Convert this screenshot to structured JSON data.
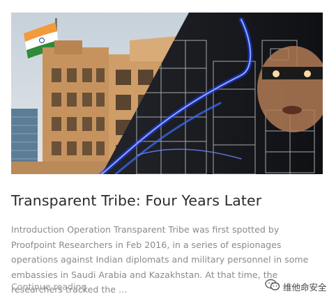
{
  "post": {
    "title": "Transparent Tribe: Four Years Later",
    "excerpt": "Introduction Operation Transparent Tribe was first spotted by Proofpoint Researchers in Feb 2016, in a series of espionages operations against Indian diplomats and military personnel in some embassies in Saudi Arabia and Kazakhstan. At that time, the researchers tracked the …",
    "continue_label": "Continue reading"
  },
  "hero": {
    "icon": "embassy-building-photo",
    "overlay": "cyber-wireframe-hacker"
  },
  "watermark": {
    "icon": "wechat-icon",
    "text": "维他命安全"
  },
  "colors": {
    "title": "#2b2b2b",
    "excerpt": "#8a8a8a",
    "link": "#9a9a9a",
    "glow": "#3c6cff"
  }
}
